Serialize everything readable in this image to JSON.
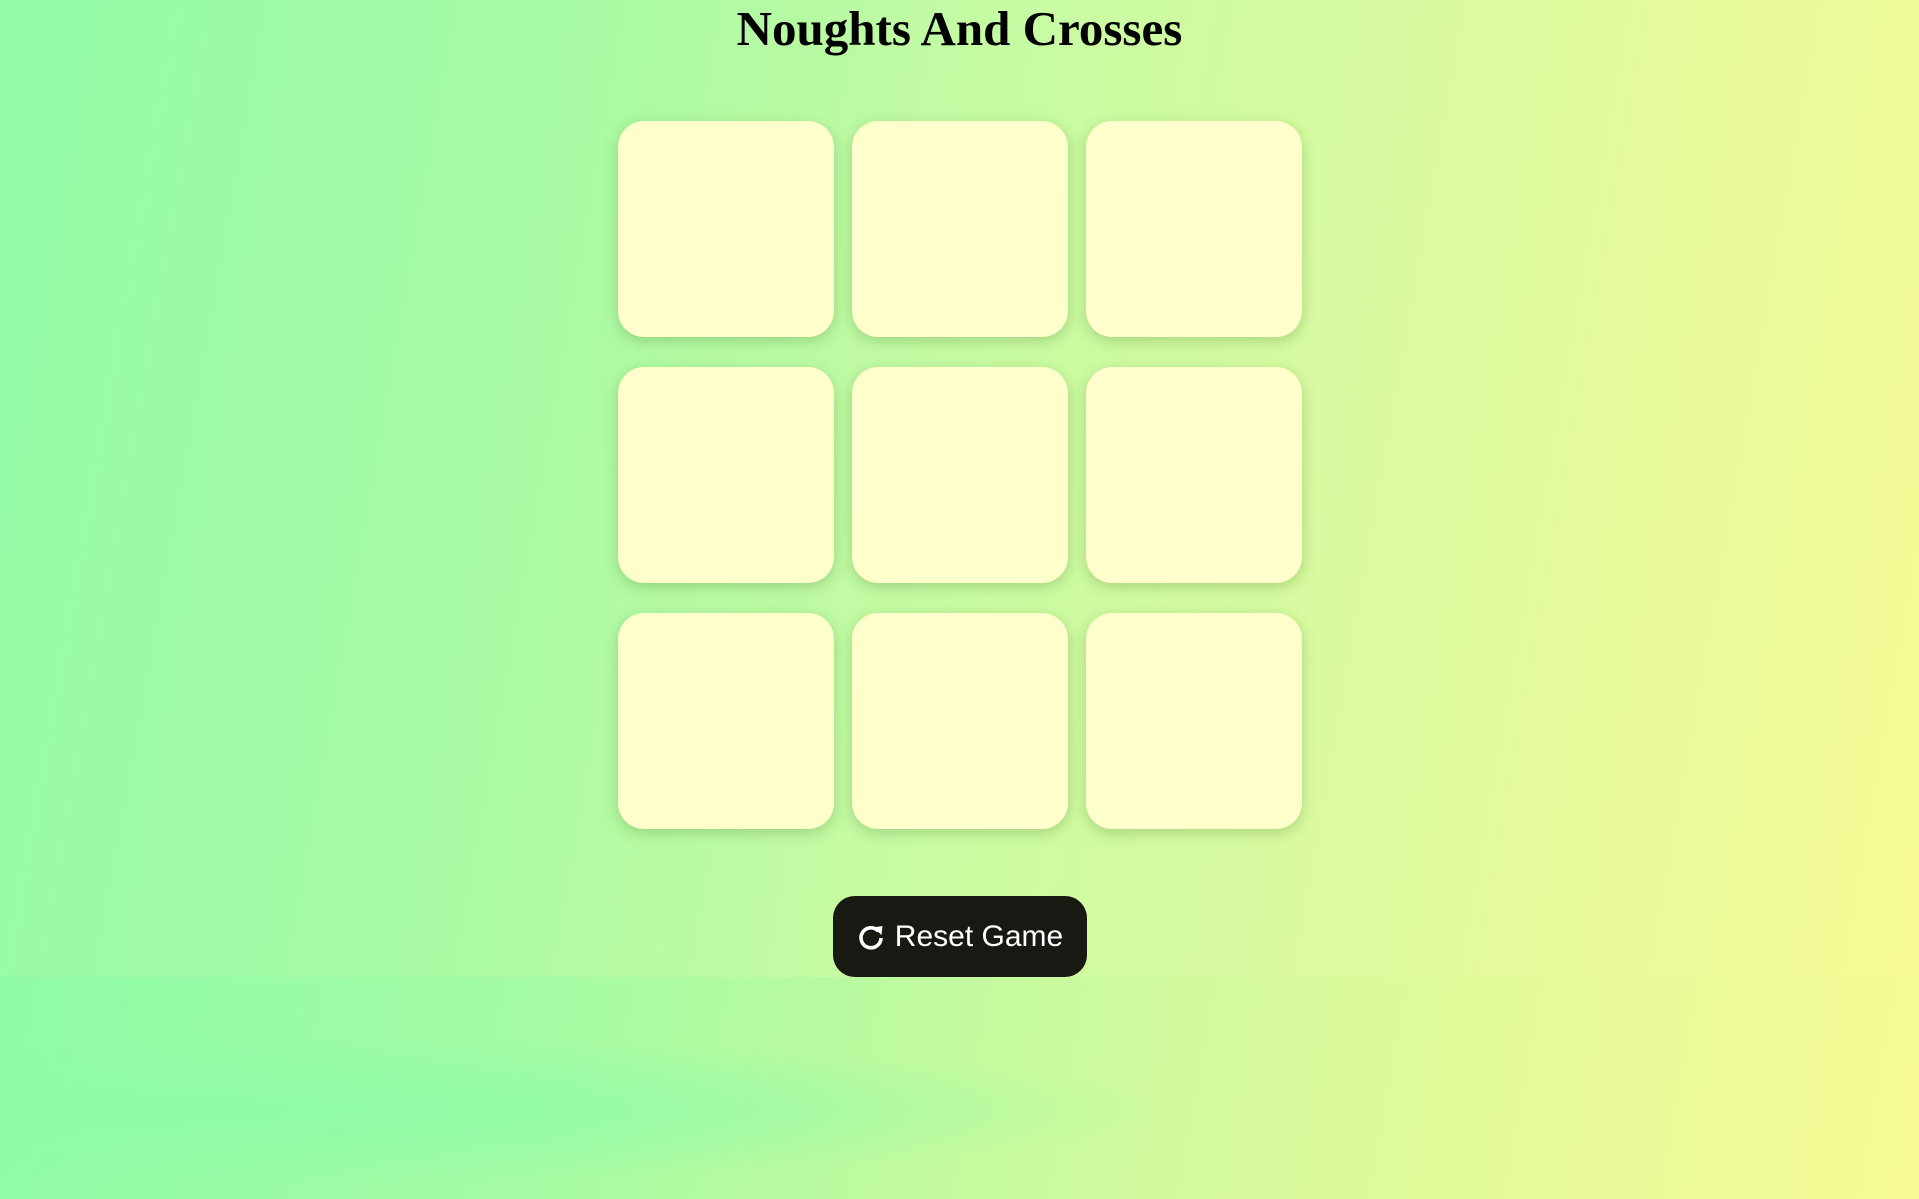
{
  "page": {
    "title": "Noughts And Crosses"
  },
  "board": {
    "cells": [
      "",
      "",
      "",
      "",
      "",
      "",
      "",
      "",
      ""
    ]
  },
  "controls": {
    "reset_label": "Reset Game",
    "reset_icon": "rotate-right-icon"
  },
  "colors": {
    "cell_background": "#ffffcc",
    "button_background": "#191914",
    "button_text": "#ffffff",
    "background_start": "#8efba8",
    "background_end": "#f6fa94"
  }
}
